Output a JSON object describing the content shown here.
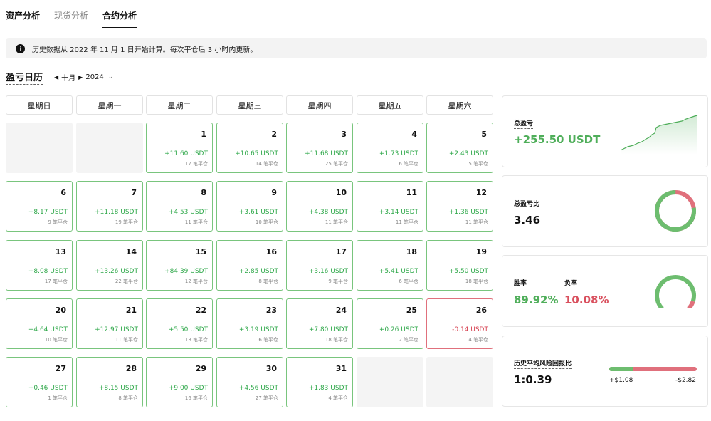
{
  "tabs": [
    "资产分析",
    "现货分析",
    "合约分析"
  ],
  "notice": {
    "text": "历史数据从 2022 年 11 月 1 日开始计算。每次平仓后 3 小时内更新。"
  },
  "calendar": {
    "title": "盈亏日历",
    "month": "十月",
    "year": "2024",
    "weekdays": [
      "星期日",
      "星期一",
      "星期二",
      "星期三",
      "星期四",
      "星期五",
      "星期六"
    ],
    "days": [
      {
        "d": "1",
        "p": "+11.60 USDT",
        "t": "17 笔平仓"
      },
      {
        "d": "2",
        "p": "+10.65 USDT",
        "t": "14 笔平仓"
      },
      {
        "d": "3",
        "p": "+11.68 USDT",
        "t": "25 笔平仓"
      },
      {
        "d": "4",
        "p": "+1.73 USDT",
        "t": "6 笔平仓"
      },
      {
        "d": "5",
        "p": "+2.43 USDT",
        "t": "5 笔平仓"
      },
      {
        "d": "6",
        "p": "+8.17 USDT",
        "t": "9 笔平仓"
      },
      {
        "d": "7",
        "p": "+11.18 USDT",
        "t": "19 笔平仓"
      },
      {
        "d": "8",
        "p": "+4.53 USDT",
        "t": "11 笔平仓"
      },
      {
        "d": "9",
        "p": "+3.61 USDT",
        "t": "10 笔平仓"
      },
      {
        "d": "10",
        "p": "+4.38 USDT",
        "t": "11 笔平仓"
      },
      {
        "d": "11",
        "p": "+3.14 USDT",
        "t": "11 笔平仓"
      },
      {
        "d": "12",
        "p": "+1.36 USDT",
        "t": "11 笔平仓"
      },
      {
        "d": "13",
        "p": "+8.08 USDT",
        "t": "17 笔平仓"
      },
      {
        "d": "14",
        "p": "+13.26 USDT",
        "t": "22 笔平仓"
      },
      {
        "d": "15",
        "p": "+84.39 USDT",
        "t": "12 笔平仓"
      },
      {
        "d": "16",
        "p": "+2.85 USDT",
        "t": "8 笔平仓"
      },
      {
        "d": "17",
        "p": "+3.16 USDT",
        "t": "9 笔平仓"
      },
      {
        "d": "18",
        "p": "+5.41 USDT",
        "t": "6 笔平仓"
      },
      {
        "d": "19",
        "p": "+5.50 USDT",
        "t": "18 笔平仓"
      },
      {
        "d": "20",
        "p": "+4.64 USDT",
        "t": "10 笔平仓"
      },
      {
        "d": "21",
        "p": "+12.97 USDT",
        "t": "11 笔平仓"
      },
      {
        "d": "22",
        "p": "+5.50 USDT",
        "t": "13 笔平仓"
      },
      {
        "d": "23",
        "p": "+3.19 USDT",
        "t": "6 笔平仓"
      },
      {
        "d": "24",
        "p": "+7.80 USDT",
        "t": "18 笔平仓"
      },
      {
        "d": "25",
        "p": "+0.26 USDT",
        "t": "2 笔平仓"
      },
      {
        "d": "26",
        "p": "-0.14 USDT",
        "t": "4 笔平仓"
      },
      {
        "d": "27",
        "p": "+0.46 USDT",
        "t": "1 笔平仓"
      },
      {
        "d": "28",
        "p": "+8.15 USDT",
        "t": "8 笔平仓"
      },
      {
        "d": "29",
        "p": "+9.00 USDT",
        "t": "16 笔平仓"
      },
      {
        "d": "30",
        "p": "+4.56 USDT",
        "t": "27 笔平仓"
      },
      {
        "d": "31",
        "p": "+1.83 USDT",
        "t": "4 笔平仓"
      }
    ]
  },
  "stats": {
    "total_pnl": {
      "label": "总盈亏",
      "value": "+255.50 USDT"
    },
    "pnl_ratio": {
      "label": "总盈亏比",
      "value": "3.46",
      "green_fraction": 0.776
    },
    "win_rate": {
      "win_label": "胜率",
      "win_value": "89.92%",
      "loss_label": "负率",
      "loss_value": "10.08%",
      "win_fraction": 0.8992
    },
    "risk_reward": {
      "label": "历史平均风险回报比",
      "value": "1:0.39",
      "avg_win": "+$1.08",
      "avg_loss": "-$2.82",
      "win_fraction": 0.277
    }
  },
  "colors": {
    "positive": "#4fae5a",
    "negative": "#d9505e",
    "positive_border": "#79c57d",
    "negative_border": "#e0707c"
  },
  "icons": {
    "notice": "info-icon",
    "prev": "triangle-left-icon",
    "next": "triangle-right-icon",
    "dropdown": "chevron-down-icon"
  }
}
